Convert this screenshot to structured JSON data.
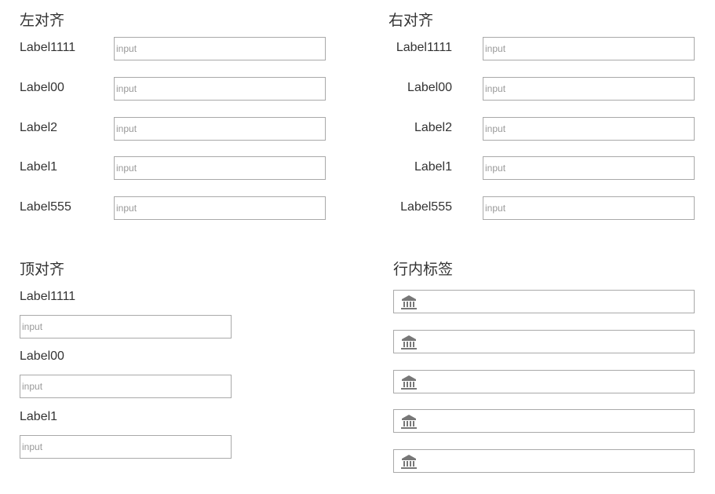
{
  "sections": {
    "left": {
      "title": "左对齐",
      "labels": [
        "Label1111",
        "Label00",
        "Label2",
        "Label1",
        "Label555"
      ]
    },
    "right": {
      "title": "右对齐",
      "labels": [
        "Label1111",
        "Label00",
        "Label2",
        "Label1",
        "Label555"
      ]
    },
    "top": {
      "title": "顶对齐",
      "labels": [
        "Label1111",
        "Label00",
        "Label1"
      ]
    },
    "inline": {
      "title": "行内标签",
      "icon": "bank-icon",
      "count": 5
    }
  },
  "placeholder": "input"
}
